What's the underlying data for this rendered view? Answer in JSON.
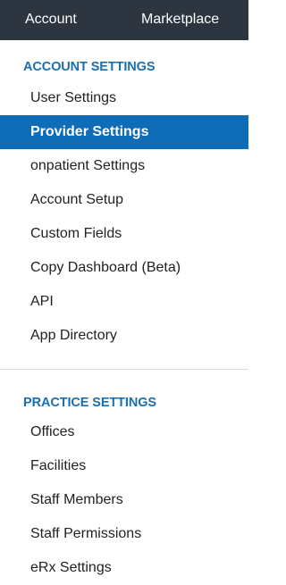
{
  "topnav": {
    "tabs": [
      {
        "label": "Account"
      },
      {
        "label": "Marketplace"
      }
    ]
  },
  "account_settings": {
    "header": "ACCOUNT SETTINGS",
    "items": [
      {
        "label": "User Settings"
      },
      {
        "label": "Provider Settings",
        "active": true
      },
      {
        "label": "onpatient Settings"
      },
      {
        "label": "Account Setup"
      },
      {
        "label": "Custom Fields"
      },
      {
        "label": "Copy Dashboard (Beta)"
      },
      {
        "label": "API"
      },
      {
        "label": "App Directory"
      }
    ]
  },
  "practice_settings": {
    "header": "PRACTICE SETTINGS",
    "items": [
      {
        "label": "Offices"
      },
      {
        "label": "Facilities"
      },
      {
        "label": "Staff Members"
      },
      {
        "label": "Staff Permissions"
      },
      {
        "label": "eRx Settings"
      }
    ]
  },
  "colors": {
    "topnav_bg": "#2c3540",
    "section_header": "#1a6fb3",
    "active_item_bg": "#0f6db8"
  }
}
